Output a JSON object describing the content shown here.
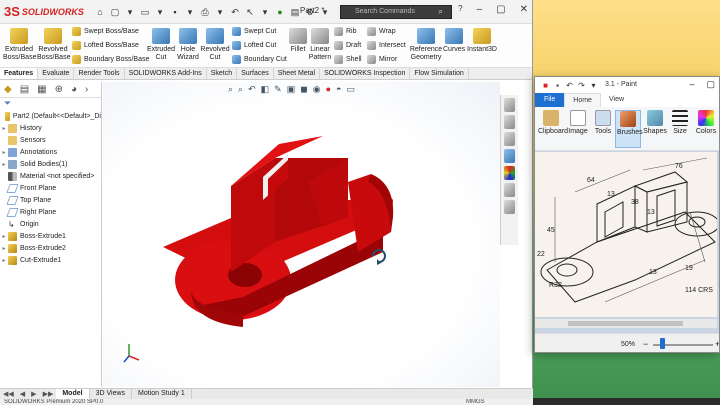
{
  "solidworks": {
    "app_name": "SOLIDWORKS",
    "document_title": "Part2 *",
    "search_placeholder": "Search Commands",
    "ribbon": {
      "extruded_boss": "Extruded Boss/Base",
      "revolved_boss": "Revolved Boss/Base",
      "swept_boss": "Swept Boss/Base",
      "lofted_boss": "Lofted Boss/Base",
      "boundary_boss": "Boundary Boss/Base",
      "extruded_cut": "Extruded Cut",
      "hole_wizard": "Hole Wizard",
      "revolved_cut": "Revolved Cut",
      "swept_cut": "Swept Cut",
      "lofted_cut": "Lofted Cut",
      "boundary_cut": "Boundary Cut",
      "fillet": "Fillet",
      "linear_pattern": "Linear Pattern",
      "rib": "Rib",
      "draft": "Draft",
      "shell": "Shell",
      "wrap": "Wrap",
      "intersect": "Intersect",
      "mirror": "Mirror",
      "reference_geometry": "Reference Geometry",
      "curves": "Curves",
      "instant3d": "Instant3D"
    },
    "command_tabs": [
      "Features",
      "Evaluate",
      "Render Tools",
      "SOLIDWORKS Add-Ins",
      "Sketch",
      "Surfaces",
      "Sheet Metal",
      "SOLIDWORKS Inspection",
      "Flow Simulation"
    ],
    "active_tab": "Features",
    "tree": {
      "root": "Part2  (Default<<Default>_Di",
      "items": [
        {
          "label": "History",
          "icon": "history-icon"
        },
        {
          "label": "Sensors",
          "icon": "sensors-icon"
        },
        {
          "label": "Annotations",
          "icon": "annotations-icon"
        },
        {
          "label": "Solid Bodies(1)",
          "icon": "solid-bodies-icon"
        },
        {
          "label": "Material <not specified>",
          "icon": "material-icon"
        },
        {
          "label": "Front Plane",
          "icon": "plane-icon"
        },
        {
          "label": "Top Plane",
          "icon": "plane-icon"
        },
        {
          "label": "Right Plane",
          "icon": "plane-icon"
        },
        {
          "label": "Origin",
          "icon": "origin-icon"
        },
        {
          "label": "Boss-Extrude1",
          "icon": "extrude-feature-icon"
        },
        {
          "label": "Boss-Extrude2",
          "icon": "extrude-feature-icon"
        },
        {
          "label": "Cut-Extrude1",
          "icon": "cut-feature-icon"
        }
      ]
    },
    "bottom_tabs": [
      "Model",
      "3D Views",
      "Motion Study 1"
    ],
    "status_left": "SOLIDWORKS Premium 2020 SP0.0",
    "status_units": "MMGS",
    "part_color": "#d0060a"
  },
  "paint": {
    "title": "3.1 - Paint",
    "tabs": [
      "File",
      "Home",
      "View"
    ],
    "groups": [
      "Clipboard",
      "Image",
      "Tools",
      "Brushes",
      "Shapes",
      "Size",
      "Colors"
    ],
    "selected_group": "Brushes",
    "zoom": "50%",
    "drawing_dims": {
      "d64": "64",
      "d13a": "13",
      "d38": "38",
      "d13b": "13",
      "d76": "76",
      "d45": "45",
      "d22": "22",
      "r32": "R32",
      "d13c": "13",
      "d19": "19",
      "holes": "114 CRS"
    }
  }
}
